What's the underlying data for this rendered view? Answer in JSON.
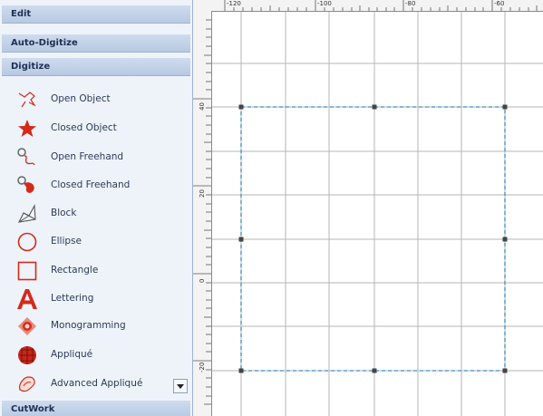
{
  "sidebar": {
    "sections": {
      "edit": "Edit",
      "auto_digitize": "Auto-Digitize",
      "digitize": "Digitize",
      "cutwork": "CutWork"
    },
    "tools": [
      {
        "label": "Open Object",
        "icon": "open-object-icon"
      },
      {
        "label": "Closed Object",
        "icon": "closed-object-icon"
      },
      {
        "label": "Open Freehand",
        "icon": "open-freehand-icon"
      },
      {
        "label": "Closed Freehand",
        "icon": "closed-freehand-icon"
      },
      {
        "label": "Block",
        "icon": "block-icon"
      },
      {
        "label": "Ellipse",
        "icon": "ellipse-icon"
      },
      {
        "label": "Rectangle",
        "icon": "rectangle-icon"
      },
      {
        "label": "Lettering",
        "icon": "lettering-icon"
      },
      {
        "label": "Monogramming",
        "icon": "monogramming-icon"
      },
      {
        "label": "Appliqué",
        "icon": "applique-icon"
      },
      {
        "label": "Advanced Appliqué",
        "icon": "advanced-applique-icon"
      }
    ]
  },
  "rulers": {
    "horizontal_labels": [
      "-120",
      "-100",
      "-80",
      "-60"
    ],
    "vertical_labels": [
      "40",
      "20",
      "0",
      "-20"
    ]
  },
  "colors": {
    "accent_red": "#d42a1a",
    "selection": "#3a8fc4",
    "grid": "#b5b5b5",
    "panel": "#eef3fa"
  }
}
